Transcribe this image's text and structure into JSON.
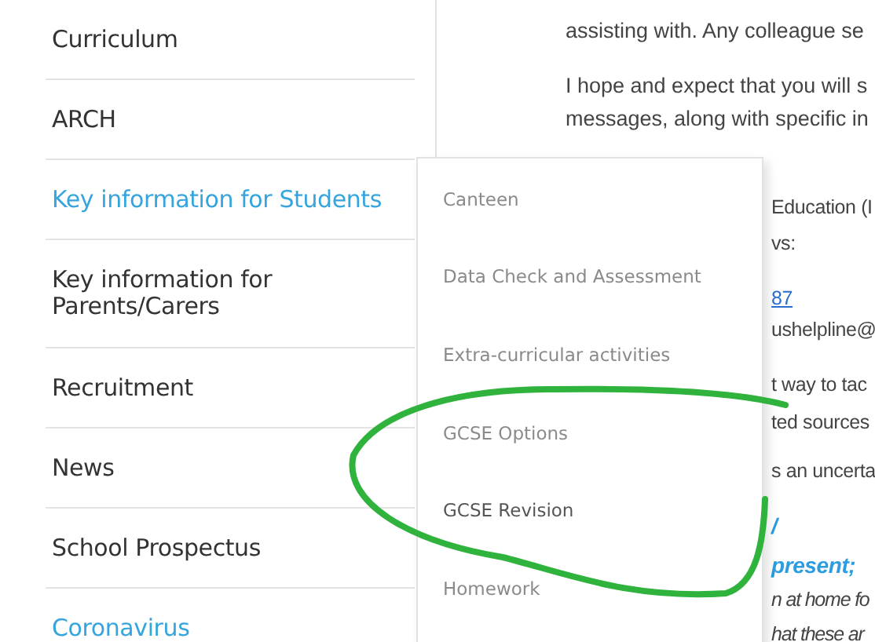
{
  "nav": {
    "items": [
      {
        "label": "Curriculum",
        "highlighted": false
      },
      {
        "label": "ARCH",
        "highlighted": false
      },
      {
        "label": "Key information for Students",
        "highlighted": true
      },
      {
        "label": "Key information for Parents/Carers",
        "highlighted": false
      },
      {
        "label": "Recruitment",
        "highlighted": false
      },
      {
        "label": "News",
        "highlighted": false
      },
      {
        "label": "School Prospectus",
        "highlighted": false
      },
      {
        "label": "Coronavirus",
        "highlighted": true
      }
    ]
  },
  "submenu": {
    "items": [
      {
        "label": "Canteen",
        "selected": false
      },
      {
        "label": "Data Check and Assessment",
        "selected": false
      },
      {
        "label": "Extra-curricular activities",
        "selected": false
      },
      {
        "label": "GCSE Options",
        "selected": false
      },
      {
        "label": "GCSE Revision",
        "selected": true
      },
      {
        "label": "Homework",
        "selected": false
      }
    ]
  },
  "content": {
    "top_lines": [
      "assisting with.  Any colleague se",
      "I hope and expect that you will s",
      "messages, along with specific in"
    ],
    "fragments": [
      {
        "kind": "text",
        "text": "Education (I"
      },
      {
        "kind": "text",
        "text": "vs:"
      },
      {
        "kind": "link",
        "text": "87"
      },
      {
        "kind": "text",
        "text": "ushelpline@"
      },
      {
        "kind": "text",
        "text": "t way to tac"
      },
      {
        "kind": "text",
        "text": "ted sources"
      },
      {
        "kind": "text",
        "text": "s an uncerta"
      },
      {
        "kind": "heading",
        "text": "/"
      },
      {
        "kind": "heading",
        "text": "present;"
      },
      {
        "kind": "italic",
        "text": "n at home fo"
      },
      {
        "kind": "italic",
        "text": "hat these ar"
      }
    ]
  }
}
